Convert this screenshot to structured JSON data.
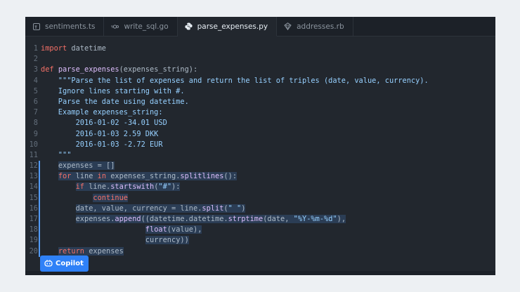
{
  "tabs": [
    {
      "label": "sentiments.ts",
      "icon": "typescript-file-icon",
      "active": false
    },
    {
      "label": "write_sql.go",
      "icon": "go-file-icon",
      "active": false
    },
    {
      "label": "parse_expenses.py",
      "icon": "python-file-icon",
      "active": true
    },
    {
      "label": "addresses.rb",
      "icon": "ruby-file-icon",
      "active": false
    }
  ],
  "code_lines": [
    {
      "n": "1",
      "tokens": [
        [
          "kw",
          "import"
        ],
        [
          "plain",
          " datetime"
        ]
      ]
    },
    {
      "n": "2",
      "tokens": []
    },
    {
      "n": "3",
      "tokens": [
        [
          "kw",
          "def"
        ],
        [
          "plain",
          " "
        ],
        [
          "fn",
          "parse_expenses"
        ],
        [
          "plain",
          "(expenses_string):"
        ]
      ]
    },
    {
      "n": "4",
      "tokens": [
        [
          "doc",
          "    \"\"\"Parse the list of expenses and return the list of triples (date, value, currency)."
        ]
      ]
    },
    {
      "n": "5",
      "tokens": [
        [
          "doc",
          "    Ignore lines starting with #."
        ]
      ]
    },
    {
      "n": "6",
      "tokens": [
        [
          "doc",
          "    Parse the date using datetime."
        ]
      ]
    },
    {
      "n": "7",
      "tokens": [
        [
          "doc",
          "    Example expenses_string:"
        ]
      ]
    },
    {
      "n": "8",
      "tokens": [
        [
          "doc",
          "        2016-01-02 -34.01 USD"
        ]
      ]
    },
    {
      "n": "9",
      "tokens": [
        [
          "doc",
          "        2016-01-03 2.59 DKK"
        ]
      ]
    },
    {
      "n": "10",
      "tokens": [
        [
          "doc",
          "        2016-01-03 -2.72 EUR"
        ]
      ]
    },
    {
      "n": "11",
      "tokens": [
        [
          "doc",
          "    \"\"\""
        ]
      ]
    },
    {
      "n": "12",
      "tokens": [
        [
          "plain",
          "    expenses = []"
        ]
      ]
    },
    {
      "n": "13",
      "tokens": [
        [
          "plain",
          "    "
        ],
        [
          "kw",
          "for"
        ],
        [
          "plain",
          " line "
        ],
        [
          "kw",
          "in"
        ],
        [
          "plain",
          " expenses_string."
        ],
        [
          "fn",
          "splitlines"
        ],
        [
          "plain",
          "():"
        ]
      ]
    },
    {
      "n": "14",
      "tokens": [
        [
          "plain",
          "        "
        ],
        [
          "kw",
          "if"
        ],
        [
          "plain",
          " line."
        ],
        [
          "fn",
          "startswith"
        ],
        [
          "plain",
          "("
        ],
        [
          "str",
          "\"#\""
        ],
        [
          "plain",
          "):"
        ]
      ]
    },
    {
      "n": "15",
      "tokens": [
        [
          "plain",
          "            "
        ],
        [
          "kw",
          "continue"
        ]
      ]
    },
    {
      "n": "16",
      "tokens": [
        [
          "plain",
          "        date, value, currency = line."
        ],
        [
          "fn",
          "split"
        ],
        [
          "plain",
          "("
        ],
        [
          "str",
          "\" \""
        ],
        [
          "plain",
          ")"
        ]
      ]
    },
    {
      "n": "17",
      "tokens": [
        [
          "plain",
          "        expenses."
        ],
        [
          "fn",
          "append"
        ],
        [
          "plain",
          "((datetime.datetime."
        ],
        [
          "fn",
          "strptime"
        ],
        [
          "plain",
          "(date, "
        ],
        [
          "str",
          "\"%Y-%m-%d\""
        ],
        [
          "plain",
          "),"
        ]
      ]
    },
    {
      "n": "18",
      "tokens": [
        [
          "plain",
          "                        "
        ],
        [
          "fn",
          "float"
        ],
        [
          "plain",
          "(value),"
        ]
      ]
    },
    {
      "n": "19",
      "tokens": [
        [
          "plain",
          "                        currency))"
        ]
      ]
    },
    {
      "n": "20",
      "tokens": [
        [
          "plain",
          "    "
        ],
        [
          "kw",
          "return"
        ],
        [
          "plain",
          " expenses"
        ]
      ]
    }
  ],
  "selection_start": 12,
  "selection_end": 20,
  "copilot": {
    "label": "Copilot",
    "icon": "copilot-icon"
  },
  "colors": {
    "accent": "#2f81f7",
    "editor_bg": "#22272e",
    "selection": "#2b3d55"
  }
}
